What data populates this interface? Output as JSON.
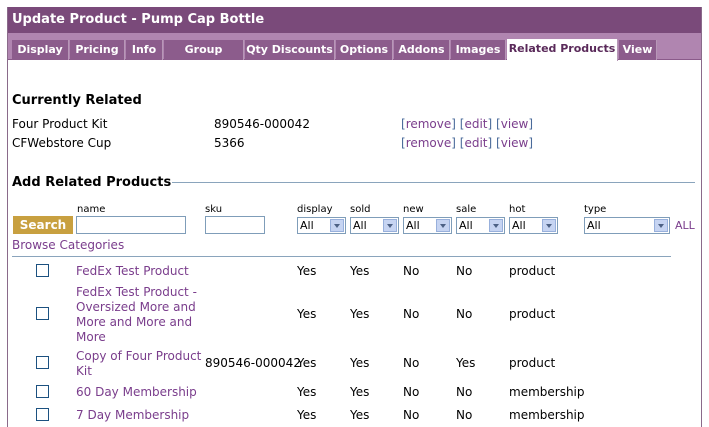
{
  "window": {
    "title": "Update Product - Pump Cap Bottle"
  },
  "tabs": [
    "Display",
    "Pricing",
    "Info",
    "Group Prices",
    "Qty Discounts",
    "Options",
    "Addons",
    "Images",
    "Related Products",
    "View"
  ],
  "active_tab": "Related Products",
  "currently_related": {
    "heading": "Currently Related",
    "items": [
      {
        "name": "Four Product Kit",
        "sku": "890546-000042"
      },
      {
        "name": "CFWebstore Cup",
        "sku": "5366"
      }
    ],
    "action_remove": "remove",
    "action_edit": "edit",
    "action_view": "view"
  },
  "add_related": {
    "heading": "Add Related Products",
    "search_button": "Search",
    "browse_link": "Browse Categories",
    "all_link": "ALL",
    "filters": {
      "name_label": "name",
      "sku_label": "sku",
      "display_label": "display",
      "display_value": "All",
      "sold_label": "sold",
      "sold_value": "All",
      "new_label": "new",
      "new_value": "All",
      "sale_label": "sale",
      "sale_value": "All",
      "hot_label": "hot",
      "hot_value": "All",
      "type_label": "type",
      "type_value": "All"
    }
  },
  "results": [
    {
      "name_lines": [
        "FedEx Test Product"
      ],
      "sku": "",
      "display": "Yes",
      "sold": "Yes",
      "new": "No",
      "sale": "No",
      "type": "product"
    },
    {
      "name_lines": [
        "FedEx Test Product -",
        "Oversized More and",
        "More and More and",
        "More"
      ],
      "sku": "",
      "display": "Yes",
      "sold": "Yes",
      "new": "No",
      "sale": "No",
      "type": "product"
    },
    {
      "name_lines": [
        "Copy of Four Product",
        "Kit"
      ],
      "sku": "890546-000042",
      "display": "Yes",
      "sold": "Yes",
      "new": "No",
      "sale": "Yes",
      "type": "product"
    },
    {
      "name_lines": [
        "60 Day Membership"
      ],
      "sku": "",
      "display": "Yes",
      "sold": "Yes",
      "new": "No",
      "sale": "No",
      "type": "membership"
    },
    {
      "name_lines": [
        "7 Day Membership"
      ],
      "sku": "",
      "display": "Yes",
      "sold": "Yes",
      "new": "No",
      "sale": "No",
      "type": "membership"
    }
  ]
}
